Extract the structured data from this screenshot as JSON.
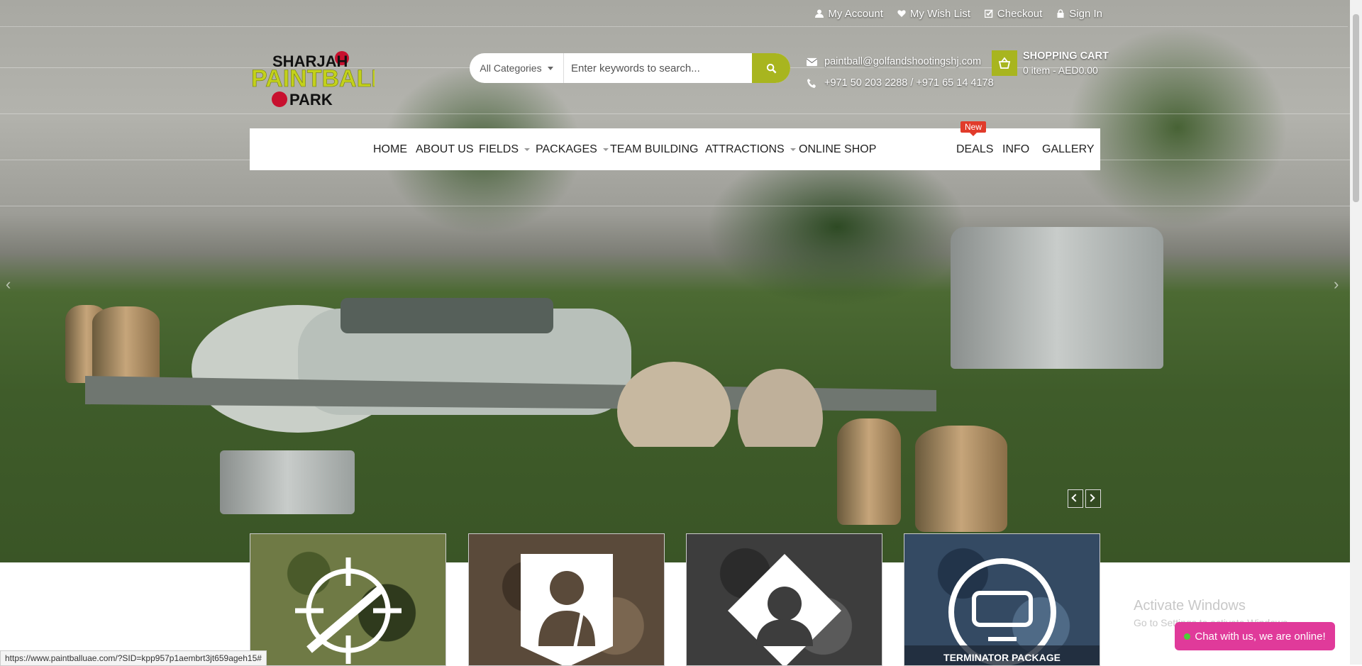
{
  "topbar": {
    "links": [
      {
        "label": "My Account",
        "icon": "user-icon"
      },
      {
        "label": "My Wish List",
        "icon": "heart-icon"
      },
      {
        "label": "Checkout",
        "icon": "checkout-icon"
      },
      {
        "label": "Sign In",
        "icon": "lock-icon"
      }
    ]
  },
  "logo": {
    "line1": "SHARJAH",
    "line2": "PAINTBALL",
    "line3": "PARK"
  },
  "search": {
    "category": "All Categories",
    "placeholder": "Enter keywords to search..."
  },
  "contact": {
    "email": "paintball@golfandshootingshj.com",
    "phone": "+971 50 203 2288 / +971 65 14 4178"
  },
  "cart": {
    "title": "SHOPPING CART",
    "summary": "0 item - AED0.00"
  },
  "nav": {
    "items": [
      {
        "label": "HOME"
      },
      {
        "label": "ABOUT US"
      },
      {
        "label": "FIELDS"
      },
      {
        "label": "PACKAGES"
      },
      {
        "label": "TEAM BUILDING"
      },
      {
        "label": "ATTRACTIONS"
      },
      {
        "label": "ONLINE SHOP"
      },
      {
        "label": "DEALS"
      },
      {
        "label": "INFO"
      },
      {
        "label": "GALLERY"
      }
    ],
    "badge": "New"
  },
  "tiles": [
    {
      "caption": "",
      "icon": "sniper-icon"
    },
    {
      "caption": "",
      "icon": "soldier-icon"
    },
    {
      "caption": "",
      "icon": "commando-icon"
    },
    {
      "caption": "TERMINATOR PACKAGE",
      "icon": "terminator-icon"
    }
  ],
  "status_url": "https://www.paintballuae.com/?SID=kpp957p1aembrt3jt659ageh15#",
  "watermark": {
    "title": "Activate Windows",
    "subtitle": "Go to Settings to activate Windows."
  },
  "chat": {
    "label": "Chat with us, we are online!"
  },
  "colors": {
    "accent": "#a8b51f",
    "badge": "#e13b2b",
    "chat": "#e03a9a"
  }
}
